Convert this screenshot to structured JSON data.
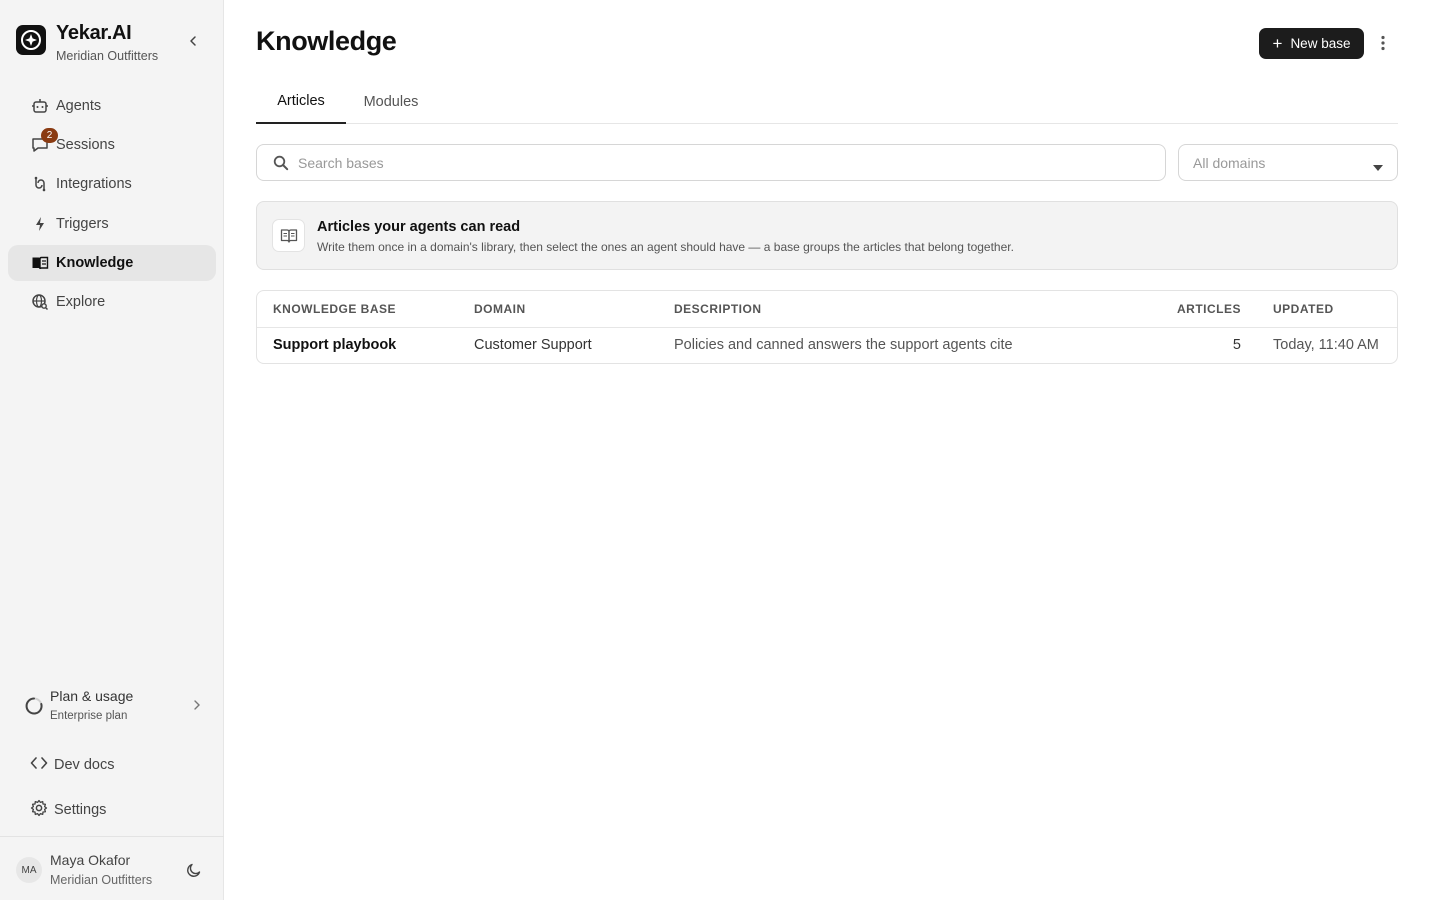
{
  "brand": {
    "name": "Yekar.AI",
    "org": "Meridian Outfitters"
  },
  "sidebar": {
    "items": [
      {
        "label": "Agents",
        "icon": "robot-icon"
      },
      {
        "label": "Sessions",
        "icon": "chat-icon",
        "badge": "2"
      },
      {
        "label": "Integrations",
        "icon": "plug-icon"
      },
      {
        "label": "Triggers",
        "icon": "bolt-icon"
      },
      {
        "label": "Knowledge",
        "icon": "book-icon",
        "active": true
      },
      {
        "label": "Explore",
        "icon": "globe-search-icon"
      }
    ],
    "plan": {
      "title": "Plan & usage",
      "subtitle": "Enterprise plan"
    },
    "dev_docs": "Dev docs",
    "settings": "Settings",
    "user": {
      "initials": "MA",
      "name": "Maya Okafor",
      "org": "Meridian Outfitters"
    }
  },
  "header": {
    "title": "Knowledge",
    "new_button": "New base"
  },
  "tabs": [
    {
      "label": "Articles",
      "active": true
    },
    {
      "label": "Modules",
      "active": false
    }
  ],
  "search": {
    "placeholder": "Search bases",
    "value": ""
  },
  "domain_filter": {
    "selected": "All domains"
  },
  "info": {
    "title": "Articles your agents can read",
    "text": "Write them once in a domain's library, then select the ones an agent should have — a base groups the articles that belong together."
  },
  "table": {
    "headers": [
      "KNOWLEDGE BASE",
      "DOMAIN",
      "DESCRIPTION",
      "ARTICLES",
      "UPDATED"
    ],
    "rows": [
      {
        "name": "Support playbook",
        "domain": "Customer Support",
        "description": "Policies and canned answers the support agents cite",
        "articles": "5",
        "updated": "Today, 11:40 AM"
      }
    ]
  },
  "colors": {
    "accent": "#1c1c1c",
    "badge": "#8a3b12",
    "sidebar_bg": "#f4f4f4"
  }
}
